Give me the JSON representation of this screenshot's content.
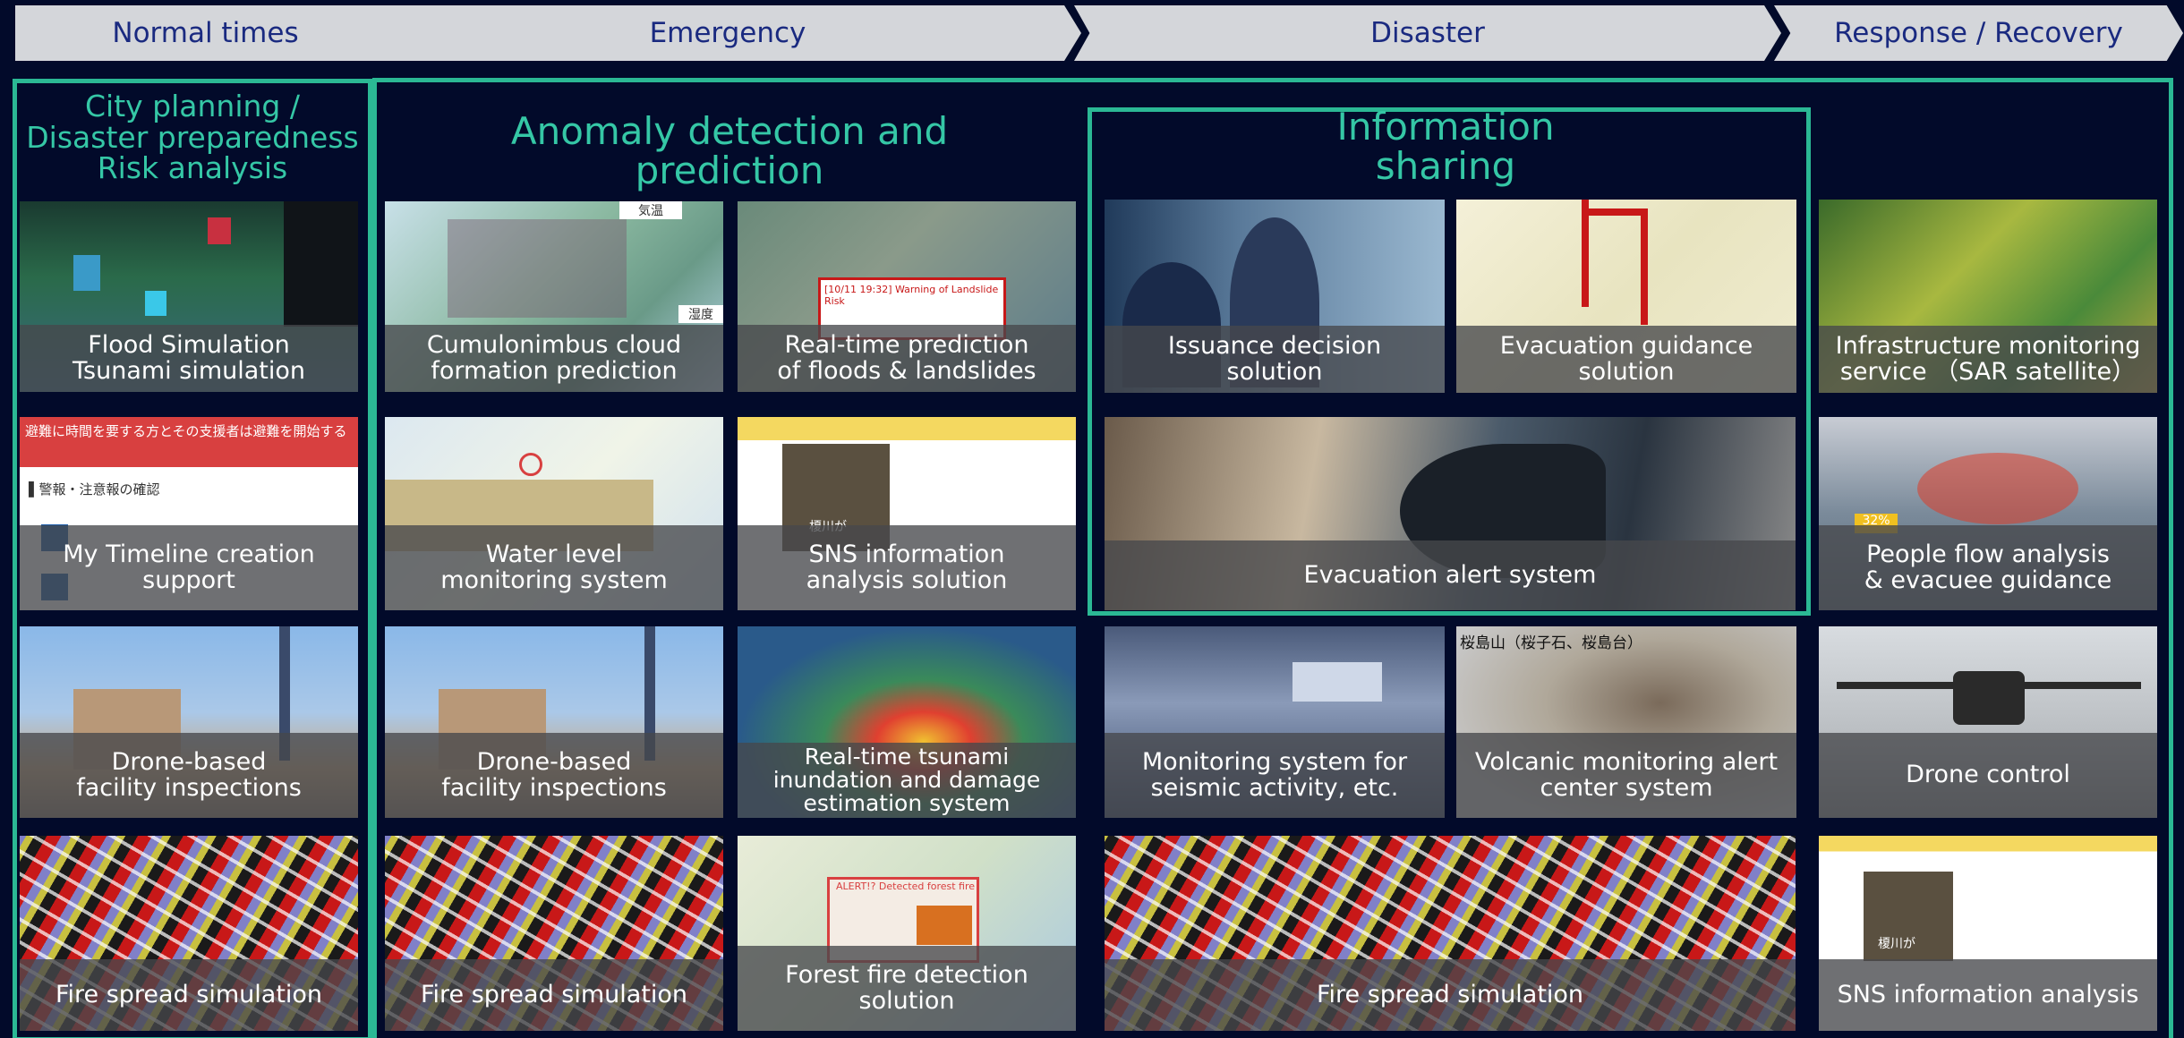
{
  "phases": [
    "Normal times",
    "Emergency",
    "Disaster",
    "Response / Recovery"
  ],
  "sections": {
    "left": "City planning /\nDisaster preparedness\nRisk analysis",
    "anomaly": "Anomaly detection and\nprediction",
    "info": "Information\nsharing"
  },
  "tiles": {
    "flood_sim": "Flood Simulation\nTsunami simulation",
    "cumulonimbus": "Cumulonimbus cloud\nformation prediction",
    "realtime_flood": "Real-time prediction\nof floods & landslides",
    "issuance": "Issuance decision\nsolution",
    "evac_guidance": "Evacuation guidance\nsolution",
    "infra_monitor": "Infrastructure monitoring\nservice （SAR satellite）",
    "my_timeline": "My Timeline creation\nsupport",
    "water_level": "Water level\nmonitoring system",
    "sns_analysis_sol": "SNS information\nanalysis solution",
    "evac_alert": "Evacuation alert system",
    "people_flow": "People flow analysis\n& evacuee guidance",
    "drone_insp_1": "Drone-based\nfacility inspections",
    "drone_insp_2": "Drone-based\nfacility inspections",
    "tsunami_est": "Real-time tsunami\ninundation and damage\nestimation system",
    "seismic": "Monitoring system for\nseismic activity, etc.",
    "volcanic": "Volcanic monitoring alert\ncenter system",
    "drone_control": "Drone control",
    "fire_1": "Fire spread simulation",
    "fire_2": "Fire spread simulation",
    "forest_fire": "Forest fire detection\nsolution",
    "fire_3": "Fire spread simulation",
    "sns_analysis": "SNS information analysis"
  },
  "image_text": {
    "kion": "気温",
    "shitsudo": "湿度",
    "timeline_header": "避難に時間を要する方とその支援者は避難を開始する",
    "timeline_check": "▌警報・注意報の確認",
    "landslide_warn": "[10/11 19:32] Warning of Landslide Risk",
    "alert_forest": "ALERT!? Detected forest fire",
    "people_pct": "32%",
    "volcano_label": "桜島山（桜子石、桜島台）",
    "sns_tag": "榎川が"
  },
  "colors": {
    "background": "#020a2a",
    "accent": "#2bb894",
    "phase_bg": "#d4d6da",
    "phase_text": "#1a2a80"
  }
}
